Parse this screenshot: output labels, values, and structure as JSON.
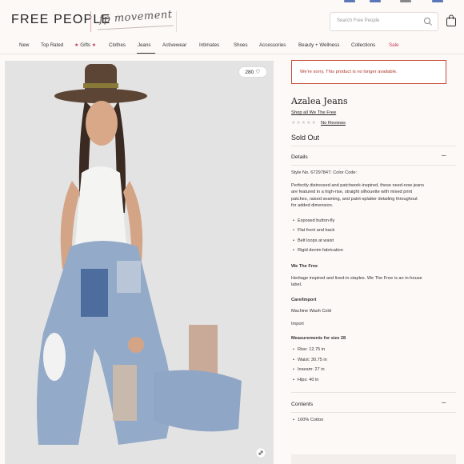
{
  "header": {
    "logo": "FREE PEOPLE",
    "sub_brand": "fp movement",
    "search_placeholder": "Search Free People"
  },
  "nav": {
    "items": [
      "New",
      "Top Rated",
      "Gifts",
      "Clothes",
      "Jeans",
      "Activewear",
      "Intimates",
      "Shoes",
      "Accessories",
      "Beauty + Wellness",
      "Collections",
      "Sale"
    ],
    "active": "Jeans"
  },
  "gallery": {
    "count": "280"
  },
  "alert": {
    "message": "We're sorry. This product is no longer available."
  },
  "product": {
    "title": "Azalea Jeans",
    "shop_all": "Shop all We The Free",
    "reviews_label": "No Reviews",
    "status": "Sold Out"
  },
  "details": {
    "heading": "Details",
    "toggle": "–",
    "style_line": "Style No. 67297847; Color Code:",
    "description": [
      "Perfectly distressed and patchwork-inspired, these need-now jeans",
      "are featured in a high-rise, straight silhouette with mixed print",
      "patches, raised seaming, and paint-splatter detailing throughout",
      "for added dimension."
    ],
    "features": [
      "Exposed button-fly",
      "Flat front and back",
      "Belt loops at waist",
      "Rigid denim fabrication"
    ],
    "brand_heading": "We The Free",
    "brand_text": [
      "Heritage inspired and lived-in staples. We The Free is an in-house",
      "label."
    ],
    "care_heading": "Care/Import",
    "care": "Machine Wash Cold",
    "import": "Import",
    "measurements_heading": "Measurements for size 28",
    "measurements": [
      "Rise: 12.75 in",
      "Waist: 30.75 in",
      "Inseam: 27 in",
      "Hips: 40 in"
    ]
  },
  "contents": {
    "heading": "Contents",
    "toggle": "–",
    "items": [
      "100% Cotton"
    ]
  },
  "colors": {
    "accent_red": "#c43a55",
    "alert_border": "#c84a3d",
    "background": "#fdf9f7"
  }
}
